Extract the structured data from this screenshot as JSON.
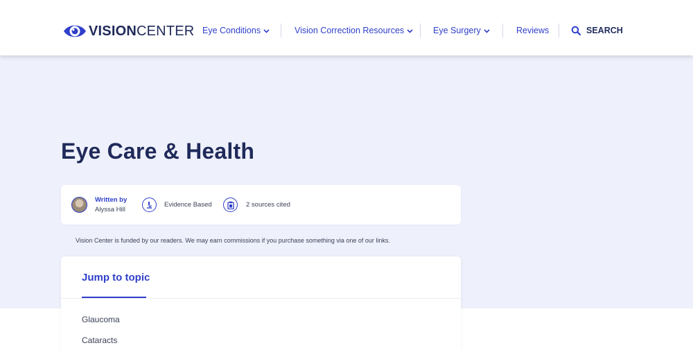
{
  "brand": {
    "bold": "VISION",
    "light": "CENTER",
    "color": "#2f3fc9"
  },
  "nav": {
    "items": [
      {
        "label": "Eye Conditions",
        "has_dropdown": true
      },
      {
        "label": "Vision Correction Resources",
        "has_dropdown": true
      },
      {
        "label": "Eye Surgery",
        "has_dropdown": true
      },
      {
        "label": "Reviews",
        "has_dropdown": false
      }
    ],
    "search_label": "SEARCH"
  },
  "page": {
    "title": "Eye Care & Health"
  },
  "meta": {
    "written_by_label": "Written by",
    "author": "Alyssa Hill",
    "evidence": "Evidence Based",
    "sources": "2 sources cited"
  },
  "disclaimer": "Vision Center is funded by our readers. We may earn commissions if you purchase something via one of our links.",
  "toc": {
    "title": "Jump to topic",
    "items": [
      "Glaucoma",
      "Cataracts"
    ]
  },
  "colors": {
    "accent": "#2f3fc9",
    "navy": "#1f2a5a",
    "hero_bg": "#eef0fb"
  }
}
